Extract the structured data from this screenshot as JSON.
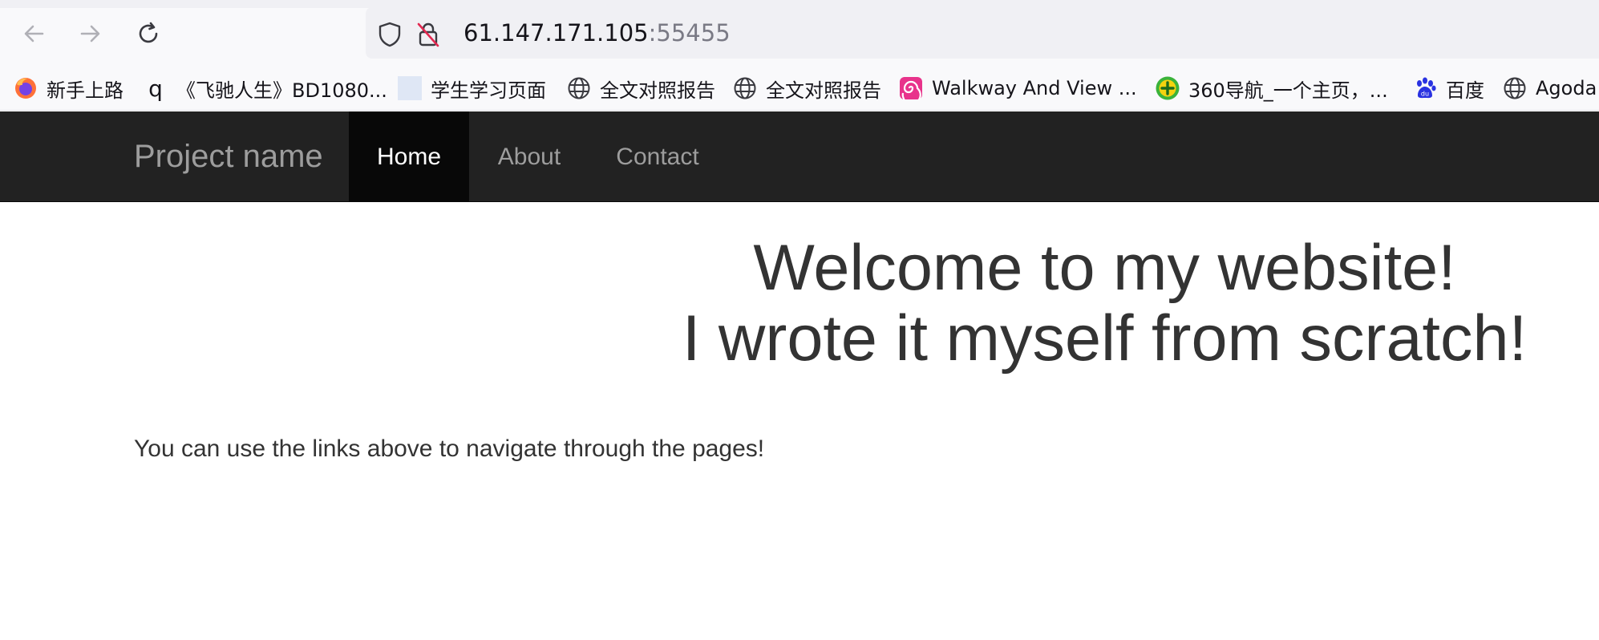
{
  "browser": {
    "address": {
      "host": "61.147.171.105",
      "port": ":55455"
    },
    "bookmarks": [
      {
        "label": "新手上路",
        "icon": "firefox-icon"
      },
      {
        "label": "《飞驰人生》BD1080...",
        "icon": "q-icon",
        "icon_glyph": "q"
      },
      {
        "label": "学生学习页面",
        "icon": "blank-page-icon"
      },
      {
        "label": "全文对照报告",
        "icon": "globe-icon"
      },
      {
        "label": "全文对照报告",
        "icon": "globe-icon"
      },
      {
        "label": "Walkway And View ...",
        "icon": "spiral-logo-icon"
      },
      {
        "label": "360导航_一个主页，...",
        "icon": "360-icon"
      },
      {
        "label": "百度",
        "icon": "baidu-paw-icon",
        "icon_glyph": "du"
      },
      {
        "label": "Agoda",
        "icon": "globe-icon"
      }
    ]
  },
  "navbar": {
    "brand": "Project name",
    "items": [
      {
        "label": "Home",
        "active": true
      },
      {
        "label": "About",
        "active": false
      },
      {
        "label": "Contact",
        "active": false
      }
    ]
  },
  "content": {
    "heading_line1": "Welcome to my website!",
    "heading_line2": "I wrote it myself from scratch!",
    "lead": "You can use the links above to navigate through the pages!"
  },
  "colors": {
    "navbar_bg": "#222222",
    "navbar_active_bg": "#080808",
    "navbar_text": "#9d9d9d",
    "body_text": "#333333"
  }
}
